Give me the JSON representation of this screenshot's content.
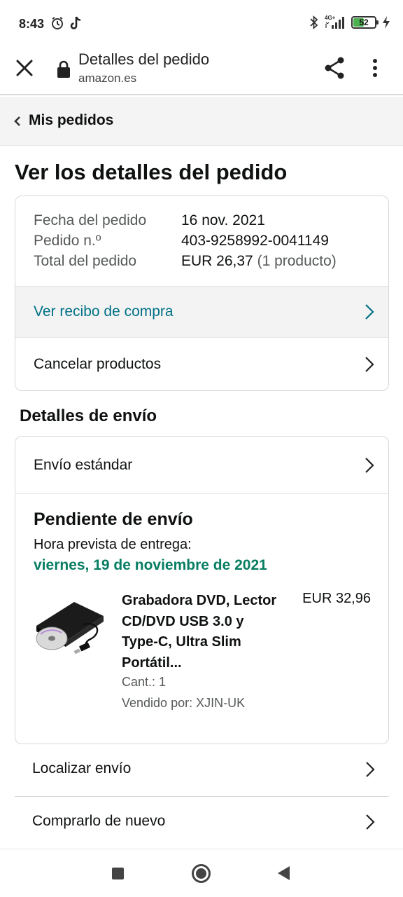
{
  "status_bar": {
    "time": "8:43",
    "battery": "52",
    "battery_level": 0.52,
    "network": "4G+",
    "icons": [
      "alarm-icon",
      "tiktok-icon",
      "bluetooth-icon",
      "signal-icon",
      "battery-icon",
      "charging-icon"
    ]
  },
  "toolbar": {
    "title": "Detalles del pedido",
    "domain": "amazon.es",
    "icons": [
      "close-icon",
      "lock-icon",
      "share-icon",
      "more-vert-icon"
    ]
  },
  "breadcrumb": {
    "label": "Mis pedidos"
  },
  "page_title": "Ver los detalles del pedido",
  "order_summary": {
    "rows": [
      {
        "label": "Fecha del pedido",
        "value": "16 nov. 2021",
        "extra": ""
      },
      {
        "label": "Pedido n.º",
        "value": "403-9258992-0041149",
        "extra": ""
      },
      {
        "label": "Total del pedido",
        "value": "EUR 26,37",
        "extra": "(1 producto)"
      }
    ],
    "receipt_link": "Ver recibo de compra",
    "cancel_label": "Cancelar productos"
  },
  "shipping": {
    "section_title": "Detalles de envío",
    "method": "Envío estándar",
    "status_title": "Pendiente de envío",
    "eta_label": "Hora prevista de entrega:",
    "eta_date": "viernes, 19 de noviembre de 2021",
    "product": {
      "name": "Grabadora DVD, Lector CD/DVD USB 3.0 y Type-C, Ultra Slim Portátil...",
      "price": "EUR 32,96",
      "quantity": "Cant.: 1",
      "seller": "Vendido por: XJIN-UK"
    }
  },
  "actions": {
    "track": "Localizar envío",
    "buy_again": "Comprarlo de nuevo"
  },
  "colors": {
    "link": "#007185",
    "success": "#067d62",
    "text": "#0f1111",
    "secondary": "#565959"
  }
}
